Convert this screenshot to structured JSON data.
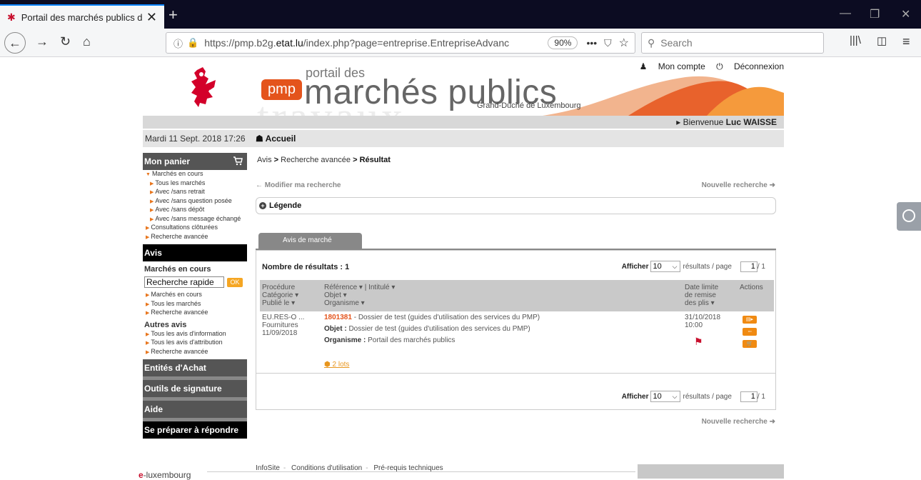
{
  "browser": {
    "tab_title": "Portail des marchés publics du",
    "url_prefix": "https://pmp.b2g.",
    "url_domain": "etat.lu",
    "url_suffix": "/index.php?page=entreprise.EntrepriseAdvanc",
    "zoom": "90%",
    "search_placeholder": "Search"
  },
  "header": {
    "portail_des": "portail des",
    "marches_publics": "marchés publics",
    "pmp": "pmp",
    "grand_duche": "Grand-Duché de Luxembourg",
    "background_word": "travaux",
    "mon_compte": "Mon compte",
    "deconnexion": "Déconnexion",
    "bienvenue": "Bienvenue",
    "user": "Luc WAISSE",
    "date": "Mardi 11 Sept. 2018 17:26",
    "accueil": "Accueil"
  },
  "sidebar": {
    "mon_panier": "Mon panier",
    "panier_items": [
      {
        "label": "Marchés en cours",
        "level": 0
      },
      {
        "label": "Tous les marchés",
        "level": 1
      },
      {
        "label": "Avec /sans retrait",
        "level": 1
      },
      {
        "label": "Avec /sans question posée",
        "level": 1
      },
      {
        "label": "Avec /sans dépôt",
        "level": 1
      },
      {
        "label": "Avec /sans message échangé",
        "level": 1
      },
      {
        "label": "Consultations clôturées",
        "level": 0
      },
      {
        "label": "Recherche avancée",
        "level": 0
      }
    ],
    "avis": "Avis",
    "marches_en_cours": "Marchés en cours",
    "quick_search": "Recherche rapide",
    "ok": "OK",
    "avis_items": [
      "Marchés en cours",
      "Tous les marchés",
      "Recherche avancée"
    ],
    "autres_avis": "Autres avis",
    "autres_items": [
      "Tous les avis d'information",
      "Tous les avis d'attribution",
      "Recherche avancée"
    ],
    "entites": "Entités d'Achat",
    "outils": "Outils de signature",
    "aide": "Aide",
    "preparer": "Se préparer à répondre"
  },
  "main": {
    "crumb_avis": "Avis",
    "crumb_recherche": "Recherche avancée",
    "crumb_resultat": "Résultat",
    "modifier": "Modifier ma recherche",
    "nouvelle": "Nouvelle recherche",
    "legende": "Légende",
    "tab_avis": "Avis de marché",
    "nb_resultats": "Nombre de résultats : 1",
    "afficher": "Afficher",
    "per_page": "10",
    "resultats_page": "résultats / page",
    "page_current": "1",
    "page_total": "/ 1",
    "headers": {
      "procedure": "Procédure",
      "categorie": "Catégorie",
      "publie": "Publié le",
      "reference": "Référence",
      "intitule": "| Intitulé",
      "objet": "Objet",
      "organisme": "Organisme",
      "date_limite_1": "Date limite",
      "date_limite_2": "de remise",
      "date_limite_3": "des plis",
      "actions": "Actions"
    },
    "row": {
      "procedure": "EU.RES-O ...",
      "categorie": "Fournitures",
      "publie": "11/09/2018",
      "reference": "1801381",
      "intitule": "- Dossier de test (guides d'utilisation des services du PMP)",
      "objet_label": "Objet :",
      "objet": "Dossier de test (guides d'utilisation des services du PMP)",
      "organisme_label": "Organisme :",
      "organisme": "Portail des marchés publics",
      "date": "31/10/2018",
      "heure": "10:00",
      "lots": "2 lots"
    }
  },
  "footer": {
    "infosite": "InfoSite",
    "conditions": "Conditions d'utilisation",
    "prerequis": "Pré-requis techniques",
    "e": "e",
    "luxembourg": "-luxembourg"
  }
}
